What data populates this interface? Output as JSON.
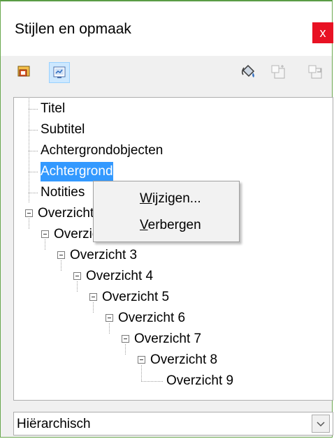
{
  "window": {
    "title": "Stijlen en opmaak",
    "close_label": "x"
  },
  "toolbar": {
    "buttons": [
      {
        "name": "presentation-styles",
        "icon": "presentation-styles-icon",
        "active": false
      },
      {
        "name": "drawing-styles",
        "icon": "drawing-styles-icon",
        "active": true
      },
      {
        "name": "fill-format-mode",
        "icon": "paint-bucket-icon"
      },
      {
        "name": "new-style-from-selection",
        "icon": "new-style-icon"
      },
      {
        "name": "update-style",
        "icon": "update-style-icon"
      }
    ]
  },
  "tree": {
    "items": [
      {
        "label": "Titel"
      },
      {
        "label": "Subtitel"
      },
      {
        "label": "Achtergrondobjecten"
      },
      {
        "label": "Achtergrond",
        "selected": true
      },
      {
        "label": "Notities"
      },
      {
        "label": "Overzicht 1"
      },
      {
        "label": "Overzicht 2"
      },
      {
        "label": "Overzicht 3"
      },
      {
        "label": "Overzicht 4"
      },
      {
        "label": "Overzicht 5"
      },
      {
        "label": "Overzicht 6"
      },
      {
        "label": "Overzicht 7"
      },
      {
        "label": "Overzicht 8"
      },
      {
        "label": "Overzicht 9"
      }
    ]
  },
  "context_menu": {
    "items": [
      {
        "accel": "W",
        "rest": "ijzigen..."
      },
      {
        "accel": "V",
        "rest": "erbergen"
      }
    ]
  },
  "filter": {
    "value": "Hiërarchisch",
    "icon": "chevron-down-icon"
  },
  "colors": {
    "selection": "#3399ff",
    "close": "#e81123",
    "active_button": "#cde8ff"
  }
}
